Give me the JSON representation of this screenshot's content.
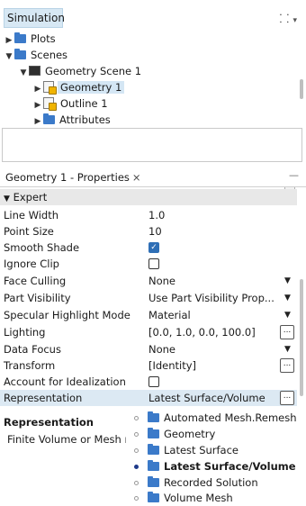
{
  "tree": {
    "title": "Simulation",
    "items": [
      {
        "label": "Plots"
      },
      {
        "label": "Scenes"
      },
      {
        "label": "Geometry Scene 1"
      },
      {
        "label": "Geometry 1"
      },
      {
        "label": "Outline 1"
      },
      {
        "label": "Attributes"
      }
    ]
  },
  "properties": {
    "tab_label": "Geometry 1 - Properties",
    "close_glyph": "×",
    "minimize_glyph": "—",
    "section": "Expert",
    "rows": [
      {
        "name": "Line Width",
        "value": "1.0"
      },
      {
        "name": "Point Size",
        "value": "10"
      },
      {
        "name": "Smooth Shade",
        "checked": true
      },
      {
        "name": "Ignore Clip",
        "checked": false
      },
      {
        "name": "Face Culling",
        "value": "None"
      },
      {
        "name": "Part Visibility",
        "value": "Use Part Visibility Prop..."
      },
      {
        "name": "Specular Highlight Mode",
        "value": "Material"
      },
      {
        "name": "Lighting",
        "value": "[0.0, 1.0, 0.0, 100.0]"
      },
      {
        "name": "Data Focus",
        "value": "None"
      },
      {
        "name": "Transform",
        "value": "[Identity]"
      },
      {
        "name": "Account for Idealization",
        "checked": false
      },
      {
        "name": "Representation",
        "value": "Latest Surface/Volume"
      }
    ],
    "ellipsis_label": "...",
    "check_glyph": "✓"
  },
  "description": {
    "title": "Representation",
    "text": "Finite Volume or Mesh r"
  },
  "dropdown": {
    "options": [
      {
        "label": "Automated Mesh.Remesh",
        "selected": false
      },
      {
        "label": "Geometry",
        "selected": false
      },
      {
        "label": "Latest Surface",
        "selected": false
      },
      {
        "label": "Latest Surface/Volume",
        "selected": true
      },
      {
        "label": "Recorded Solution",
        "selected": false
      },
      {
        "label": "Volume Mesh",
        "selected": false
      }
    ]
  },
  "colors": {
    "selection": "#d4e6f4",
    "folder": "#3b7ac9",
    "checkbox_checked": "#2f6fb6"
  }
}
